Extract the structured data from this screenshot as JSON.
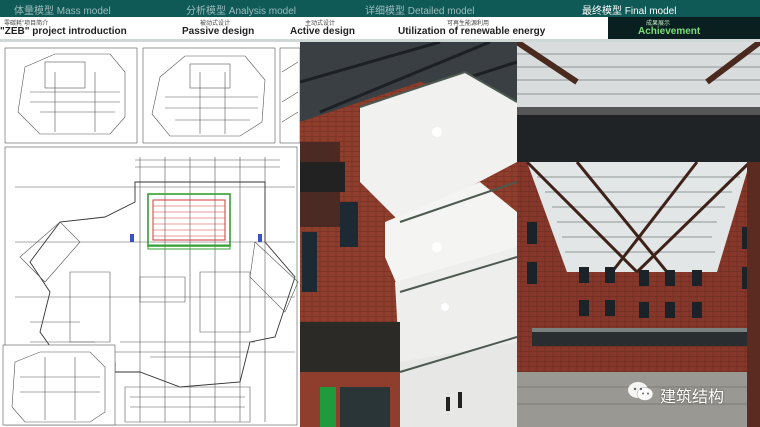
{
  "topnav": {
    "items": [
      {
        "label": "体量模型 Mass model",
        "active": false
      },
      {
        "label": "分析模型 Analysis model",
        "active": false
      },
      {
        "label": "详细模型 Detailed model",
        "active": false
      },
      {
        "label": "最终模型 Final model",
        "active": true
      }
    ]
  },
  "subnav": {
    "items": [
      {
        "cn": "零碳耗\"项目简介",
        "en": "\"ZEB\" project introduction",
        "active": false
      },
      {
        "cn": "被动式设计",
        "en": "Passive design",
        "active": false
      },
      {
        "cn": "主动式设计",
        "en": "Active design",
        "active": false
      },
      {
        "cn": "可再生能源利用",
        "en": "Utilization of renewable energy",
        "active": false
      },
      {
        "cn": "成果展示",
        "en": "Achievement",
        "active": true
      }
    ]
  },
  "watermark": {
    "text": "建筑结构"
  },
  "colors": {
    "nav_bg": "#0f5a57",
    "active_bg": "#0a2020",
    "active_text": "#7bdc78",
    "brick": "#8a3a2a"
  }
}
